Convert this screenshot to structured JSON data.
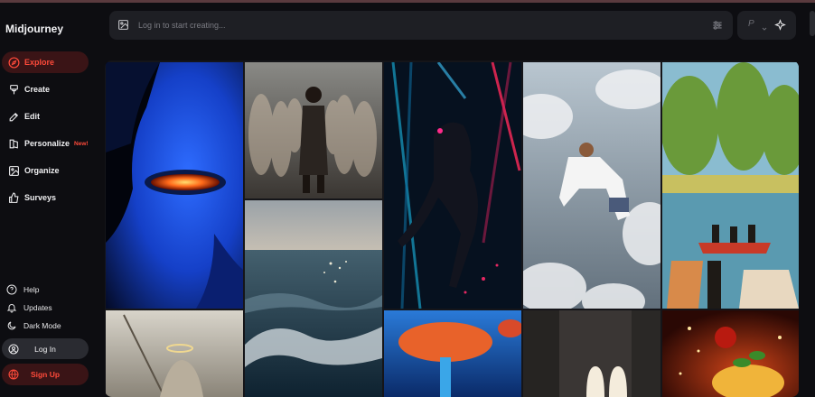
{
  "app": {
    "logo": "Midjourney"
  },
  "sidebar": {
    "items": [
      {
        "label": "Explore",
        "icon": "compass-icon",
        "active": true
      },
      {
        "label": "Create",
        "icon": "brush-icon"
      },
      {
        "label": "Edit",
        "icon": "edit-icon"
      },
      {
        "label": "Personalize",
        "icon": "book-icon",
        "badge": "New!"
      },
      {
        "label": "Organize",
        "icon": "image-icon"
      },
      {
        "label": "Surveys",
        "icon": "thumbs-up-icon"
      }
    ],
    "bottom": [
      {
        "label": "Help",
        "icon": "help-icon"
      },
      {
        "label": "Updates",
        "icon": "bell-icon"
      },
      {
        "label": "Dark Mode",
        "icon": "moon-icon"
      }
    ],
    "login_label": "Log In",
    "signup_label": "Sign Up"
  },
  "search": {
    "placeholder": "Log in to start creating..."
  },
  "topright": {
    "p_label": "P"
  },
  "colors": {
    "accent": "#ff4a3a",
    "active_bg": "#3a1416",
    "panel": "#1e1f24",
    "bg": "#0d0d11"
  }
}
